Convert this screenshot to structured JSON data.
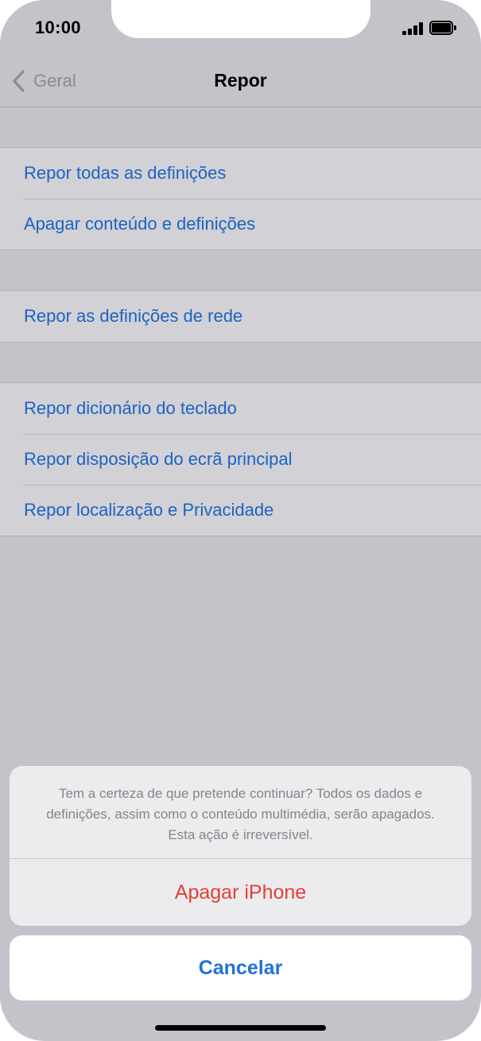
{
  "status_bar": {
    "time": "10:00",
    "signal_icon": "signal-icon",
    "battery_icon": "battery-icon"
  },
  "nav": {
    "back_label": "Geral",
    "back_icon": "chevron-left-icon",
    "title": "Repor"
  },
  "groups": [
    {
      "items": [
        {
          "label": "Repor todas as definições"
        },
        {
          "label": "Apagar conteúdo e definições"
        }
      ]
    },
    {
      "items": [
        {
          "label": "Repor as definições de rede"
        }
      ]
    },
    {
      "items": [
        {
          "label": "Repor dicionário do teclado"
        },
        {
          "label": "Repor disposição do ecrã principal"
        },
        {
          "label": "Repor localização e Privacidade"
        }
      ]
    }
  ],
  "action_sheet": {
    "message": "Tem a certeza de que pretende continuar? Todos os dados e definições, assim como o conteúdo multimédia, serão apagados. Esta ação é irreversível.",
    "destructive_label": "Apagar iPhone",
    "cancel_label": "Cancelar"
  },
  "colors": {
    "link_blue": "#1d63c2",
    "destructive_red": "#e34033",
    "cancel_blue": "#1f73d8"
  }
}
